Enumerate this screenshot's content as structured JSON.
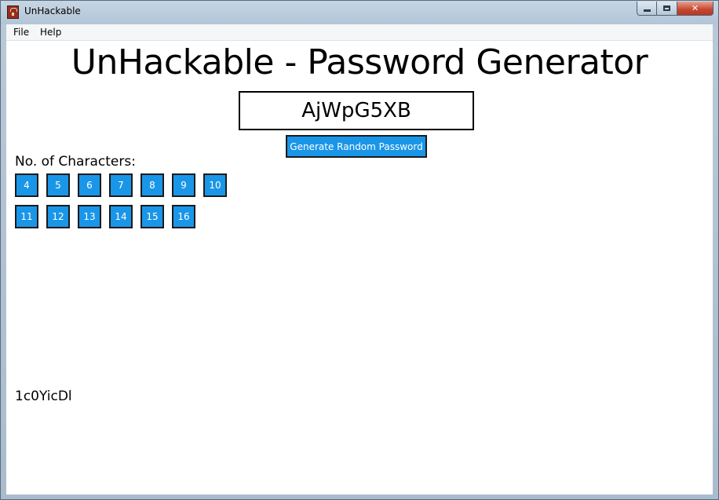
{
  "window": {
    "title": "UnHackable",
    "controls": {
      "minimize": "minimize",
      "maximize": "maximize",
      "close": "✕"
    }
  },
  "menu": {
    "file": "File",
    "help": "Help"
  },
  "app": {
    "heading": "UnHackable - Password Generator",
    "password": "AjWpG5XB",
    "generate_label": "Generate Random Password",
    "chars_label": "No. of Characters:",
    "lengths_row1": [
      "4",
      "5",
      "6",
      "7",
      "8",
      "9",
      "10"
    ],
    "lengths_row2": [
      "11",
      "12",
      "13",
      "14",
      "15",
      "16"
    ],
    "previous_password": "1c0YicDl"
  },
  "colors": {
    "button_blue": "#1a96e8",
    "button_border": "#1b1b1b",
    "close_red": "#c6462f"
  },
  "icons": [
    "app-lock-icon",
    "minimize-icon",
    "maximize-icon",
    "close-icon"
  ]
}
